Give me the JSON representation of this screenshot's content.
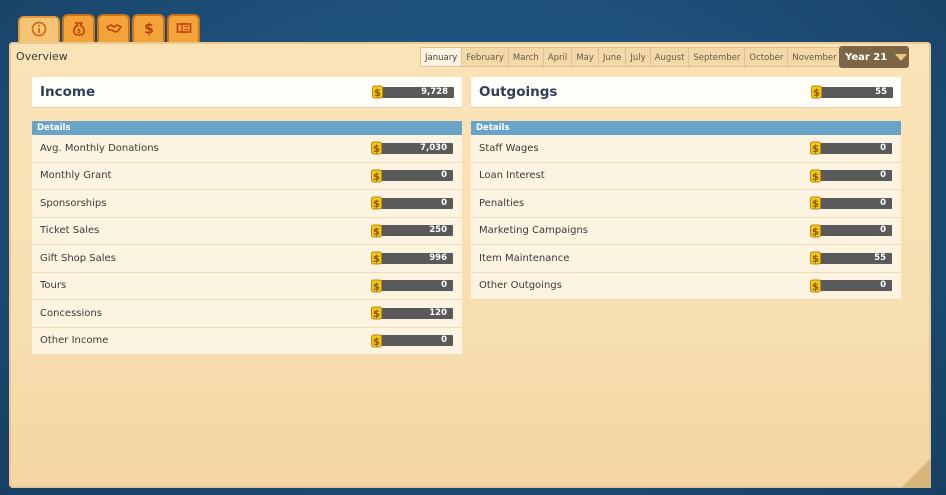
{
  "tabs": [
    {
      "icon": "info-icon",
      "glyph": "ⓘ",
      "active": true
    },
    {
      "icon": "money-bag-icon",
      "glyph": "💰"
    },
    {
      "icon": "handshake-icon",
      "glyph": "🤝"
    },
    {
      "icon": "dollar-icon",
      "glyph": "$"
    },
    {
      "icon": "ticket-icon",
      "glyph": "🎫"
    }
  ],
  "header": {
    "overview": "Overview",
    "months": [
      "January",
      "February",
      "March",
      "April",
      "May",
      "June",
      "July",
      "August",
      "September",
      "October",
      "November"
    ],
    "active_month": "January",
    "year": "Year 21"
  },
  "income": {
    "title": "Income",
    "total": "9,728",
    "details_label": "Details",
    "rows": [
      {
        "label": "Avg. Monthly Donations",
        "value": "7,030"
      },
      {
        "label": "Monthly Grant",
        "value": "0"
      },
      {
        "label": "Sponsorships",
        "value": "0"
      },
      {
        "label": "Ticket Sales",
        "value": "250"
      },
      {
        "label": "Gift Shop Sales",
        "value": "996"
      },
      {
        "label": "Tours",
        "value": "0"
      },
      {
        "label": "Concessions",
        "value": "120"
      },
      {
        "label": "Other Income",
        "value": "0"
      }
    ]
  },
  "outgoings": {
    "title": "Outgoings",
    "total": "55",
    "details_label": "Details",
    "rows": [
      {
        "label": "Staff Wages",
        "value": "0"
      },
      {
        "label": "Loan Interest",
        "value": "0"
      },
      {
        "label": "Penalties",
        "value": "0"
      },
      {
        "label": "Marketing Campaigns",
        "value": "0"
      },
      {
        "label": "Item Maintenance",
        "value": "55"
      },
      {
        "label": "Other Outgoings",
        "value": "0"
      }
    ]
  },
  "colors": {
    "tab_orange": "#f2a33a",
    "panel": "#fbe3b7",
    "details_blue": "#6aa3c8",
    "value_bar": "#5a5a5a",
    "coin_yellow": "#f5c518"
  }
}
